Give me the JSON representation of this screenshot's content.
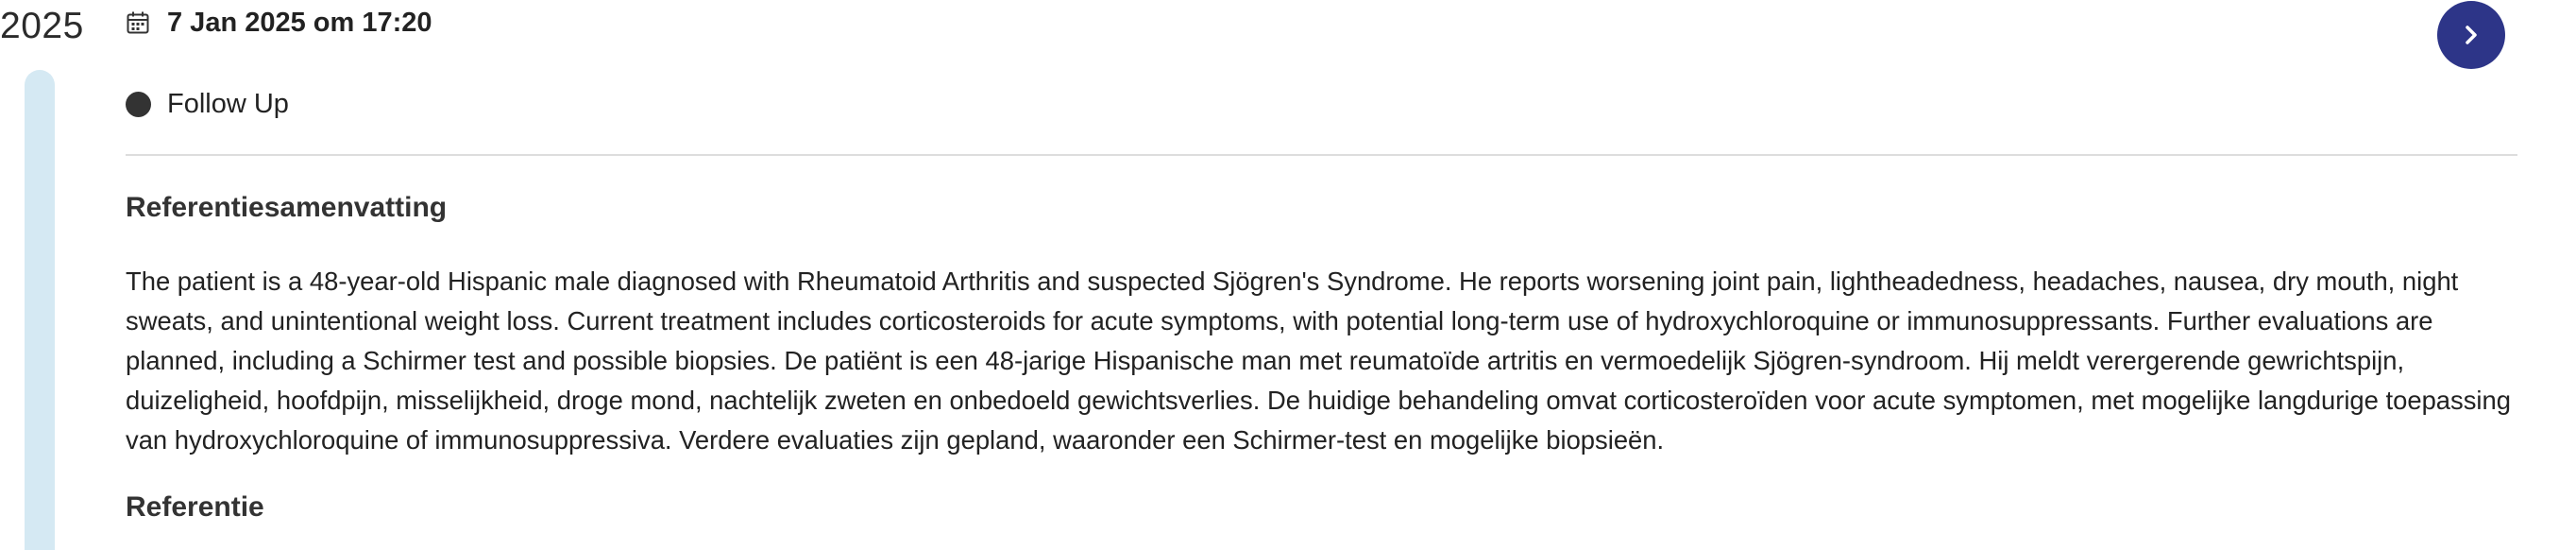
{
  "timeline": {
    "year": "2025"
  },
  "header": {
    "date": "7 Jan 2025 om 17:20",
    "status": "Follow Up"
  },
  "sections": [
    {
      "title": "Referentiesamenvatting",
      "text": "The patient is a 48-year-old Hispanic male diagnosed with Rheumatoid Arthritis and suspected Sjögren's Syndrome. He reports worsening joint pain, lightheadedness, headaches, nausea, dry mouth, night sweats, and unintentional weight loss. Current treatment includes corticosteroids for acute symptoms, with potential long-term use of hydroxychloroquine or immunosuppressants. Further evaluations are planned, including a Schirmer test and possible biopsies. De patiënt is een 48-jarige Hispanische man met reumatoïde artritis en vermoedelijk Sjögren-syndroom. Hij meldt verergerende gewrichtspijn, duizeligheid, hoofdpijn, misselijkheid, droge mond, nachtelijk zweten en onbedoeld gewichtsverlies. De huidige behandeling omvat corticosteroïden voor acute symptomen, met mogelijke langdurige toepassing van hydroxychloroquine of immunosuppressiva. Verdere evaluaties zijn gepland, waaronder een Schirmer-test en mogelijke biopsieën."
    },
    {
      "title": "Referentie"
    }
  ],
  "icons": {
    "calendar": "calendar-icon",
    "next": "chevron-right-icon",
    "status": "status-dot"
  },
  "colors": {
    "next_button_bg": "#2d3588",
    "timeline_bar": "#d5e9f3",
    "status_dot": "#333333"
  }
}
